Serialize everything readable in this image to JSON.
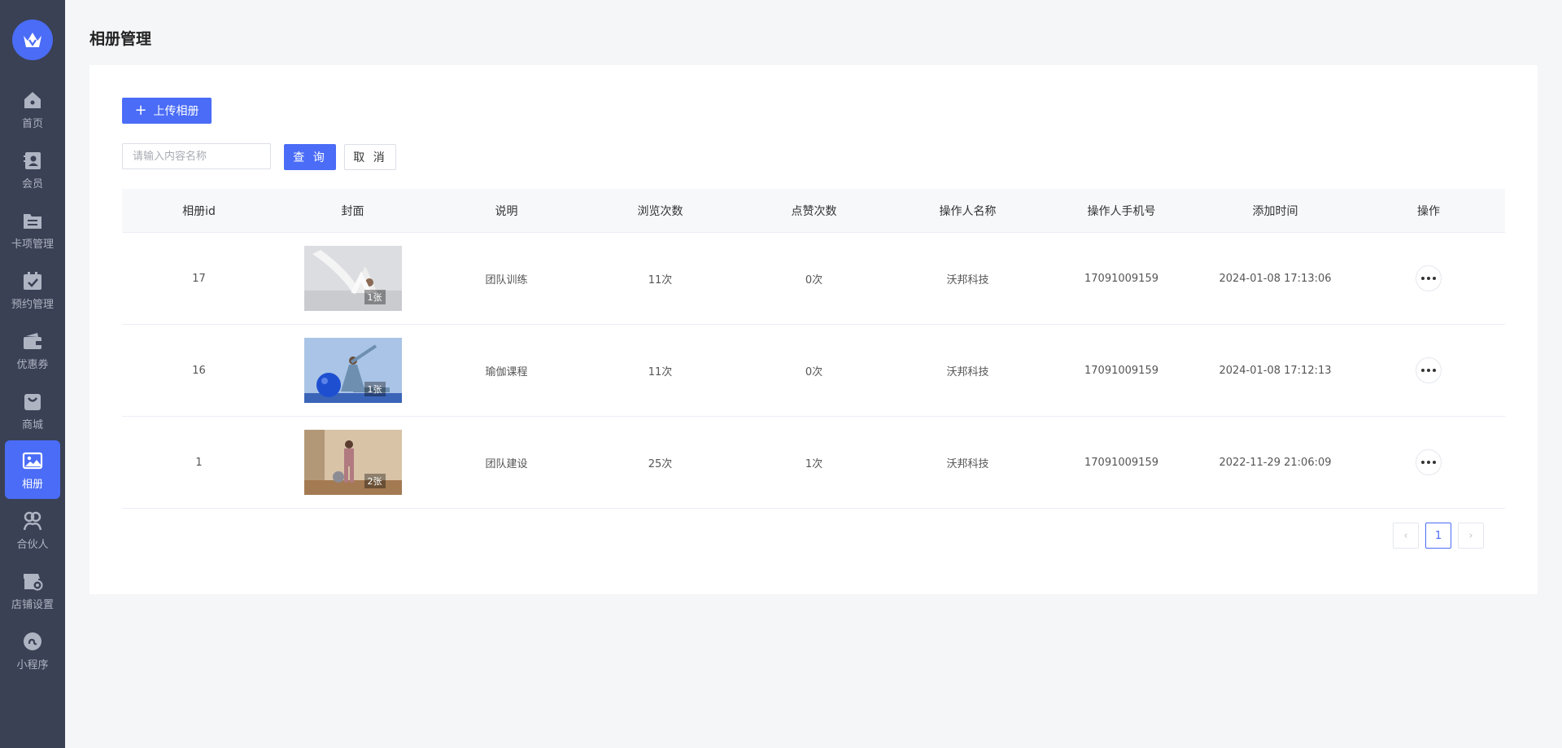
{
  "sidebar": {
    "items": [
      {
        "label": "首页",
        "icon": "home-icon"
      },
      {
        "label": "会员",
        "icon": "member-icon"
      },
      {
        "label": "卡项管理",
        "icon": "card-icon"
      },
      {
        "label": "预约管理",
        "icon": "calendar-icon"
      },
      {
        "label": "优惠券",
        "icon": "wallet-icon"
      },
      {
        "label": "商城",
        "icon": "shopping-bag-icon"
      },
      {
        "label": "相册",
        "icon": "image-icon",
        "active": true
      },
      {
        "label": "合伙人",
        "icon": "partner-icon"
      },
      {
        "label": "店铺设置",
        "icon": "store-settings-icon"
      },
      {
        "label": "小程序",
        "icon": "mini-program-icon"
      }
    ]
  },
  "page": {
    "title": "相册管理"
  },
  "toolbar": {
    "upload_label": "上传相册"
  },
  "search": {
    "placeholder": "请输入内容名称",
    "query_label": "查 询",
    "cancel_label": "取 消"
  },
  "table": {
    "headers": [
      "相册id",
      "封面",
      "说明",
      "浏览次数",
      "点赞次数",
      "操作人名称",
      "操作人手机号",
      "添加时间",
      "操作"
    ],
    "rows": [
      {
        "id": "17",
        "cover_count": "1张",
        "desc": "团队训练",
        "views": "11次",
        "likes": "0次",
        "operator": "沃邦科技",
        "phone": "17091009159",
        "time": "2024-01-08 17:13:06"
      },
      {
        "id": "16",
        "cover_count": "1张",
        "desc": "瑜伽课程",
        "views": "11次",
        "likes": "0次",
        "operator": "沃邦科技",
        "phone": "17091009159",
        "time": "2024-01-08 17:12:13"
      },
      {
        "id": "1",
        "cover_count": "2张",
        "desc": "团队建设",
        "views": "25次",
        "likes": "1次",
        "operator": "沃邦科技",
        "phone": "17091009159",
        "time": "2022-11-29 21:06:09"
      }
    ]
  },
  "pagination": {
    "prev": "‹",
    "current": "1",
    "next": "›"
  },
  "colors": {
    "accent": "#4a6cf7",
    "sidebar_bg": "#3a4154"
  }
}
